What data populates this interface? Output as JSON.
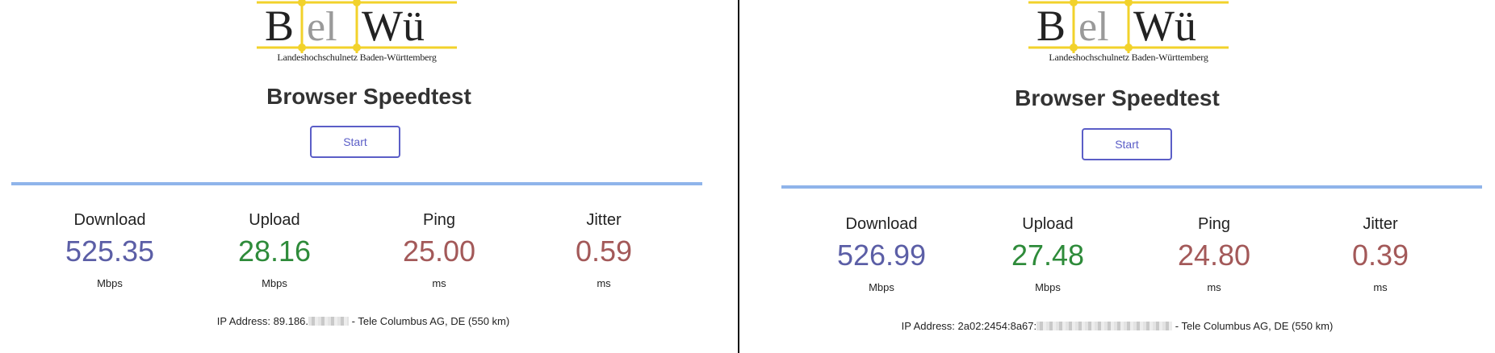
{
  "colors": {
    "accent": "#5b5ec7",
    "download": "#5b5ea6",
    "upload": "#2e8b3a",
    "ping": "#a35959",
    "jitter": "#a35959",
    "bar": "#8fb4ea",
    "logo_grid": "#f2d22b"
  },
  "logo": {
    "letter_b": "B",
    "letters_el": "el",
    "letters_wu": "Wü",
    "subtitle": "Landeshochschulnetz Baden-Württemberg"
  },
  "left": {
    "title": "Browser Speedtest",
    "start_label": "Start",
    "metrics": [
      {
        "label": "Download",
        "value": "525.35",
        "unit": "Mbps"
      },
      {
        "label": "Upload",
        "value": "28.16",
        "unit": "Mbps"
      },
      {
        "label": "Ping",
        "value": "25.00",
        "unit": "ms"
      },
      {
        "label": "Jitter",
        "value": "0.59",
        "unit": "ms"
      }
    ],
    "ip_prefix": "IP Address: 89.186.",
    "ip_suffix": "- Tele Columbus AG, DE (550 km)"
  },
  "right": {
    "title": "Browser Speedtest",
    "start_label": "Start",
    "metrics": [
      {
        "label": "Download",
        "value": "526.99",
        "unit": "Mbps"
      },
      {
        "label": "Upload",
        "value": "27.48",
        "unit": "Mbps"
      },
      {
        "label": "Ping",
        "value": "24.80",
        "unit": "ms"
      },
      {
        "label": "Jitter",
        "value": "0.39",
        "unit": "ms"
      }
    ],
    "ip_prefix": "IP Address: 2a02:2454:8a67:",
    "ip_suffix": "- Tele Columbus AG, DE (550 km)"
  }
}
